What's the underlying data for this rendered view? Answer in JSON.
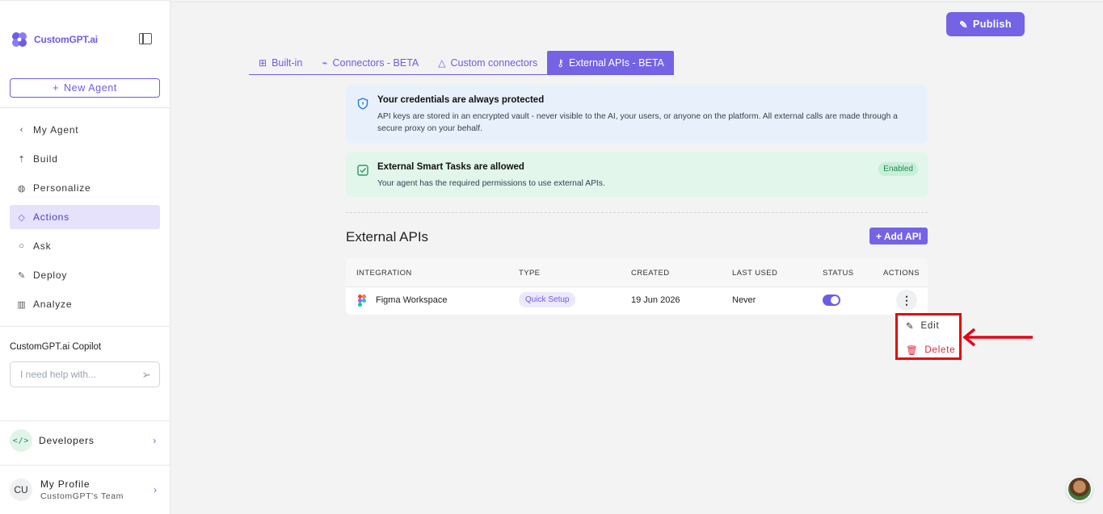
{
  "sidebar": {
    "logo_text": "CustomGPT.ai",
    "new_agent": "New Agent",
    "back_label": "My Agent",
    "items": [
      {
        "label": "Build",
        "icon": "build-icon"
      },
      {
        "label": "Personalize",
        "icon": "palette-icon"
      },
      {
        "label": "Actions",
        "icon": "actions-icon",
        "active": true
      },
      {
        "label": "Ask",
        "icon": "chat-icon"
      },
      {
        "label": "Deploy",
        "icon": "rocket-icon"
      },
      {
        "label": "Analyze",
        "icon": "chart-icon"
      }
    ],
    "copilot_title": "CustomGPT.ai Copilot",
    "copilot_placeholder": "I need help with...",
    "developers": "Developers",
    "profile_initials": "CU",
    "profile_name": "My Profile",
    "profile_team": "CustomGPT's Team"
  },
  "header": {
    "publish": "Publish"
  },
  "tabs": [
    {
      "label": "Built-in",
      "icon": "grid-icon"
    },
    {
      "label": "Connectors - BETA",
      "icon": "plug-icon"
    },
    {
      "label": "Custom connectors",
      "icon": "shapes-icon"
    },
    {
      "label": "External APIs - BETA",
      "icon": "key-icon",
      "active": true
    }
  ],
  "credentials_card": {
    "title": "Your credentials are always protected",
    "body": "API keys are stored in an encrypted vault - never visible to the AI, your users, or anyone on the platform. All external calls are made through a secure proxy on your behalf."
  },
  "smart_tasks_card": {
    "title": "External Smart Tasks are allowed",
    "body": "Your agent has the required permissions to use external APIs.",
    "badge": "Enabled"
  },
  "section": {
    "title": "External APIs",
    "add_button": "+ Add API"
  },
  "table": {
    "headers": [
      "INTEGRATION",
      "TYPE",
      "CREATED",
      "LAST USED",
      "STATUS",
      "ACTIONS"
    ],
    "rows": [
      {
        "integration": "Figma Workspace",
        "type": "Quick Setup",
        "created": "19 Jun 2026",
        "last_used": "Never",
        "status_on": true
      }
    ]
  },
  "menu": {
    "edit": "Edit",
    "delete": "Delete"
  },
  "colors": {
    "accent": "#7563e6",
    "highlight": "#e30613",
    "danger": "#e0253a"
  }
}
